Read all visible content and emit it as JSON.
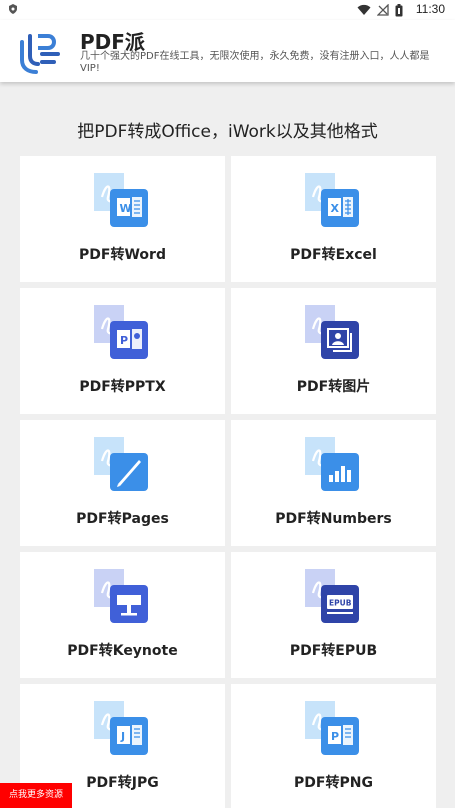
{
  "status_bar": {
    "time": "11:30",
    "icons": [
      "shield-icon",
      "wifi-icon",
      "signal-off-icon",
      "battery-icon"
    ]
  },
  "header": {
    "logo_icon": "pdfpai-logo-icon",
    "title": "PDF派",
    "subtitle": "几十个强大的PDF在线工具，无限次使用，永久免费，没有注册入口，人人都是VIP!"
  },
  "section_title": "把PDF转成Office，iWork以及其他格式",
  "colors": {
    "accent_blue": "#3b8fe8",
    "dark_blue": "#2f44a8",
    "light_blue": "#c7e3fa",
    "promo_red": "#ff0000"
  },
  "cards": [
    {
      "label": "PDF转Word",
      "icon": "word-icon"
    },
    {
      "label": "PDF转Excel",
      "icon": "excel-icon"
    },
    {
      "label": "PDF转PPTX",
      "icon": "powerpoint-icon"
    },
    {
      "label": "PDF转图片",
      "icon": "image-icon"
    },
    {
      "label": "PDF转Pages",
      "icon": "pages-icon"
    },
    {
      "label": "PDF转Numbers",
      "icon": "numbers-icon"
    },
    {
      "label": "PDF转Keynote",
      "icon": "keynote-icon"
    },
    {
      "label": "PDF转EPUB",
      "icon": "epub-icon"
    },
    {
      "label": "PDF转JPG",
      "icon": "jpg-icon"
    },
    {
      "label": "PDF转PNG",
      "icon": "png-icon"
    }
  ],
  "promo_button": "点我更多资源",
  "epub_text": "EPUB"
}
